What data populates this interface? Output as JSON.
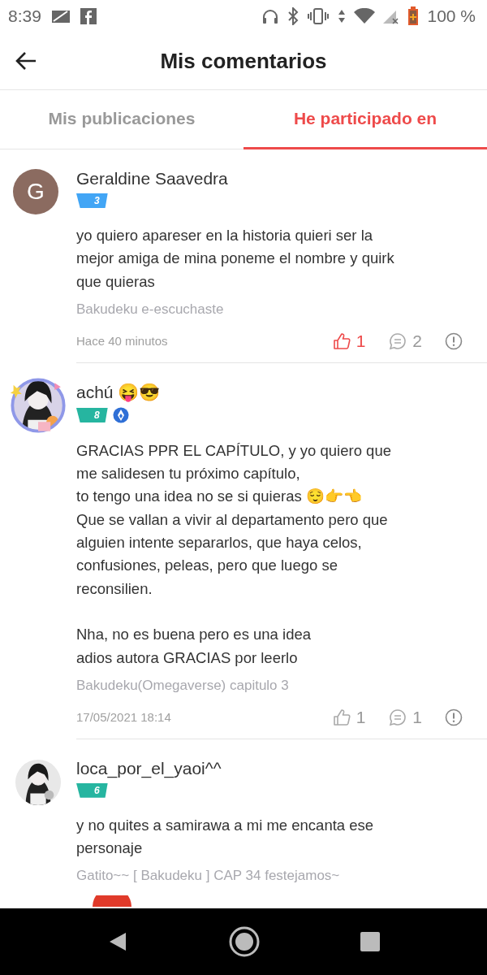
{
  "status_bar": {
    "time": "8:39",
    "battery": "100 %"
  },
  "header": {
    "title": "Mis comentarios"
  },
  "tabs": [
    {
      "label": "Mis publicaciones",
      "selected": false
    },
    {
      "label": "He participado en",
      "selected": true
    }
  ],
  "comments": [
    {
      "avatar": {
        "kind": "letter",
        "letter": "G",
        "color": "#8b6b60"
      },
      "name": "Geraldine Saavedra",
      "level_badge": {
        "label": "3",
        "color": "#42a5f5"
      },
      "role_badge": false,
      "text": "yo quiero apareser en la historia quieri ser la\nmejor amiga de mina poneme el nombre y quirk\nque quieras",
      "source": "Bakudeku e-escuchaste",
      "time": "Hace 40 minutos",
      "liked": true,
      "likes": "1",
      "replies": "2"
    },
    {
      "avatar": {
        "kind": "picture",
        "framed": true
      },
      "name": "achú 😝😎",
      "level_badge": {
        "label": "8",
        "color": "#26b5a0"
      },
      "role_badge": true,
      "text": "GRACIAS PPR EL CAPÍTULO, y yo quiero que\nme salidesen tu próximo capítulo,\nto tengo una idea no se si quieras 😌👉👈\nQue se vallan a vivir al departamento pero que\nalguien intente separarlos, que haya celos,\nconfusiones, peleas, pero que luego se\nreconsilien.\n\nNha, no es buena pero es una idea\nadios autora GRACIAS por leerlo",
      "source": "Bakudeku(Omegaverse) capitulo 3",
      "time": "17/05/2021 18:14",
      "liked": false,
      "likes": "1",
      "replies": "1"
    },
    {
      "avatar": {
        "kind": "picture",
        "framed": false
      },
      "name": "loca_por_el_yaoi^^",
      "level_badge": {
        "label": "6",
        "color": "#26b5a0"
      },
      "role_badge": false,
      "text": "y no quites a samirawa a mi me encanta ese\npersonaje",
      "source": "Gatito~~ [ Bakudeku ] CAP 34 festejamos~"
    }
  ]
}
